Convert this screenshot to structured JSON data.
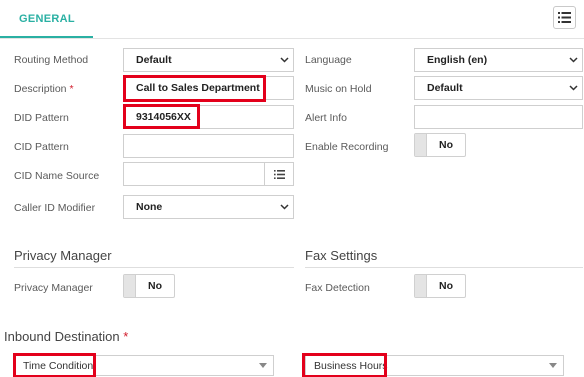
{
  "tabs": {
    "general": "GENERAL"
  },
  "left": {
    "routing_method": {
      "label": "Routing Method",
      "value": "Default"
    },
    "description": {
      "label": "Description",
      "required": "*",
      "value": "Call to Sales Department"
    },
    "did_pattern": {
      "label": "DID Pattern",
      "value": "9314056XX"
    },
    "cid_pattern": {
      "label": "CID Pattern",
      "value": ""
    },
    "cid_name_source": {
      "label": "CID Name Source",
      "value": ""
    },
    "caller_id_modifier": {
      "label": "Caller ID Modifier",
      "value": "None"
    }
  },
  "right": {
    "language": {
      "label": "Language",
      "value": "English (en)"
    },
    "music_on_hold": {
      "label": "Music on Hold",
      "value": "Default"
    },
    "alert_info": {
      "label": "Alert Info",
      "value": ""
    },
    "enable_recording": {
      "label": "Enable Recording",
      "value": "No"
    }
  },
  "privacy": {
    "title": "Privacy Manager",
    "label": "Privacy Manager",
    "value": "No"
  },
  "fax": {
    "title": "Fax Settings",
    "label": "Fax Detection",
    "value": "No"
  },
  "inbound": {
    "title": "Inbound Destination",
    "required": "*",
    "destination_type": "Time Condition",
    "destination_target": "Business Hours"
  },
  "colors": {
    "accent": "#2ab0a3",
    "highlight": "#e3001b",
    "required": "#d11a2a"
  },
  "icons": {
    "list_button": "list-icon",
    "caret": "chevron-down-icon",
    "cid_button": "list-icon"
  }
}
